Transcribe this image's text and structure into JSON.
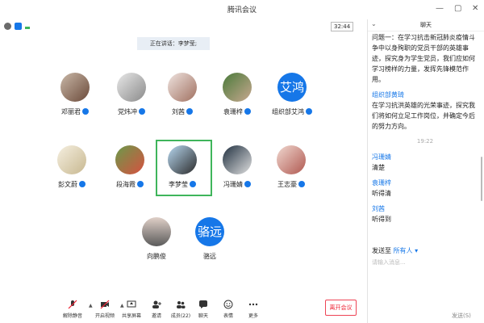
{
  "window": {
    "title": "腾讯会议"
  },
  "status": {
    "timer": "32:44",
    "speaking": "正在讲话：李梦莹;"
  },
  "participants": [
    {
      "name": "邓丽君"
    },
    {
      "name": "党炜冲"
    },
    {
      "name": "刘茜"
    },
    {
      "name": "袁珊梓"
    },
    {
      "name": "组织部艾鸿",
      "avatar_text": "艾鸿"
    },
    {
      "name": "彭文蔚"
    },
    {
      "name": "段海霞"
    },
    {
      "name": "李梦莹"
    },
    {
      "name": "冯珊婧"
    },
    {
      "name": "王志豪"
    },
    {
      "name": "向鹏俊"
    },
    {
      "name": "骆远",
      "avatar_text": "骆远"
    }
  ],
  "toolbar": {
    "mute": "解除静音",
    "video": "开启视频",
    "share": "共享屏幕",
    "invite": "邀请",
    "members": "成员(22)",
    "chat": "聊天",
    "reactions": "表情",
    "more": "更多",
    "leave": "离开会议"
  },
  "chat": {
    "title": "聊天",
    "intro": "问题一：在学习抗击新冠肺炎疫情斗争中以身殉职的党员干部的英雄事迹，探究身为学生党员，我们应如何学习榜样的力量，发挥先锋模范作用。",
    "messages": [
      {
        "sender": "组织部黄琦",
        "text": "在学习抗洪英雄的光荣事迹，探究我们将如何立足工作岗位，并确定今后的努力方向。"
      }
    ],
    "timestamp": "19:22",
    "messages2": [
      {
        "sender": "冯珊婧",
        "text": "清楚"
      },
      {
        "sender": "袁珊梓",
        "text": "听得清"
      },
      {
        "sender": "刘茜",
        "text": "听得到"
      }
    ],
    "send_to_label": "发送至",
    "send_to_target": "所有人",
    "input_placeholder": "请输入消息...",
    "send_button": "发送(S)"
  },
  "colors": {
    "accent": "#1677e8",
    "highlight": "#3fb55b",
    "leave": "#e23"
  }
}
